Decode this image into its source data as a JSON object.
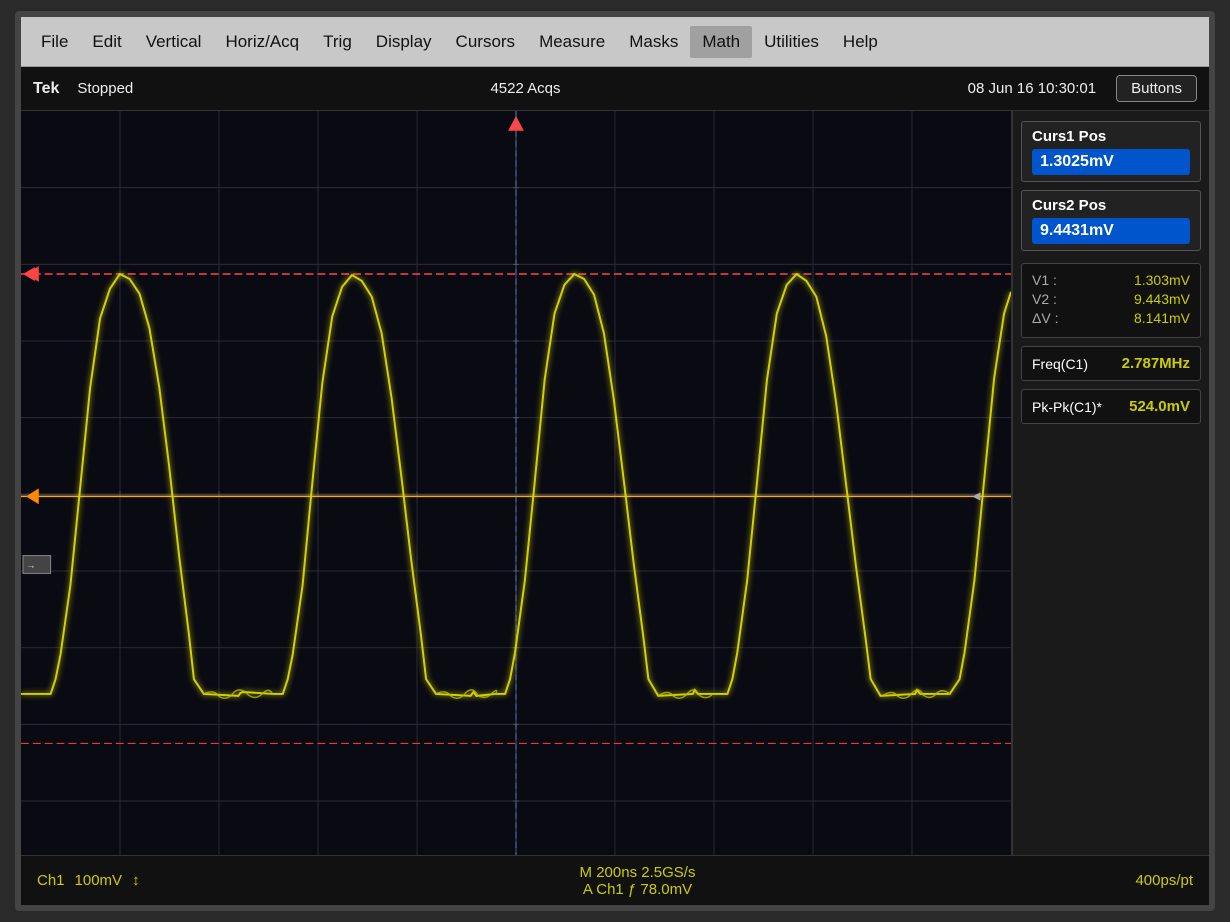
{
  "menu": {
    "items": [
      "File",
      "Edit",
      "Vertical",
      "Horiz/Acq",
      "Trig",
      "Display",
      "Cursors",
      "Measure",
      "Masks",
      "Math",
      "Utilities",
      "Help"
    ]
  },
  "status": {
    "brand": "Tek",
    "state": "Stopped",
    "acquisitions": "4522 Acqs",
    "datetime": "08 Jun 16 10:30:01",
    "buttons_label": "Buttons"
  },
  "cursors": {
    "curs1_label": "Curs1 Pos",
    "curs1_value": "1.3025mV",
    "curs2_label": "Curs2 Pos",
    "curs2_value": "9.4431mV"
  },
  "measurements": {
    "v1_label": "V1 :",
    "v1_value": "1.303mV",
    "v2_label": "V2 :",
    "v2_value": "9.443mV",
    "dv_label": "ΔV :",
    "dv_value": "8.141mV",
    "freq_label": "Freq(C1)",
    "freq_value": "2.787MHz",
    "pkpk_label": "Pk-Pk(C1)*",
    "pkpk_value": "524.0mV"
  },
  "bottom": {
    "ch1_label": "Ch1",
    "ch1_scale": "100mV",
    "ch1_symbol": "↕",
    "center_label": "M 200ns  2.5GS/s",
    "center_line2": "A Ch1  ƒ  78.0mV",
    "right_label": "400ps/pt"
  }
}
